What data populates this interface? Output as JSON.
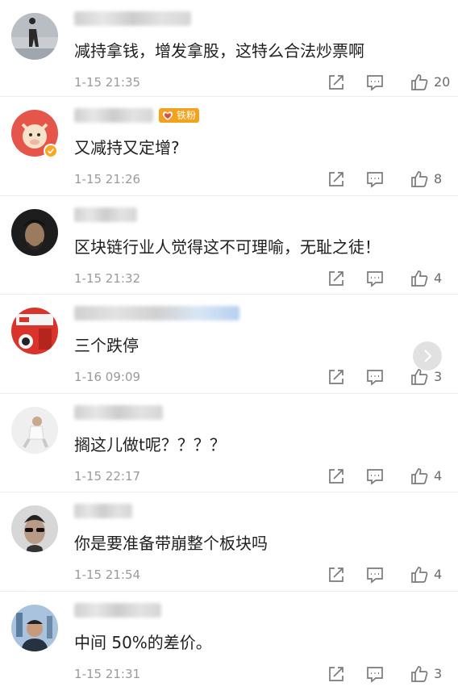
{
  "comments": [
    {
      "text": "减持拿钱，增发拿股，这特么合法炒票啊",
      "time": "1-15 21:35",
      "likes": "20",
      "badge": ""
    },
    {
      "text": "又减持又定增?",
      "time": "1-15 21:26",
      "likes": "8",
      "badge": "铁粉"
    },
    {
      "text": "区块链行业人觉得这不可理喻，无耻之徒！",
      "time": "1-15 21:32",
      "likes": "4",
      "badge": ""
    },
    {
      "text": "三个跌停",
      "time": "1-16 09:09",
      "likes": "3",
      "badge": ""
    },
    {
      "text": "搁这儿做t呢？？？？",
      "time": "1-15 22:17",
      "likes": "4",
      "badge": ""
    },
    {
      "text": "你是要准备带崩整个板块吗",
      "time": "1-15 21:54",
      "likes": "4",
      "badge": ""
    },
    {
      "text": "中间 50%的差价。",
      "time": "1-15 21:31",
      "likes": "3",
      "badge": ""
    }
  ],
  "colors": {
    "accent": "#f4a21c",
    "meta": "#9a9a9a",
    "icon": "#7a7a7a"
  },
  "icons": {
    "share": "share-icon",
    "reply": "comment-icon",
    "like": "thumbs-up-icon",
    "next": "chevron-right-icon"
  }
}
